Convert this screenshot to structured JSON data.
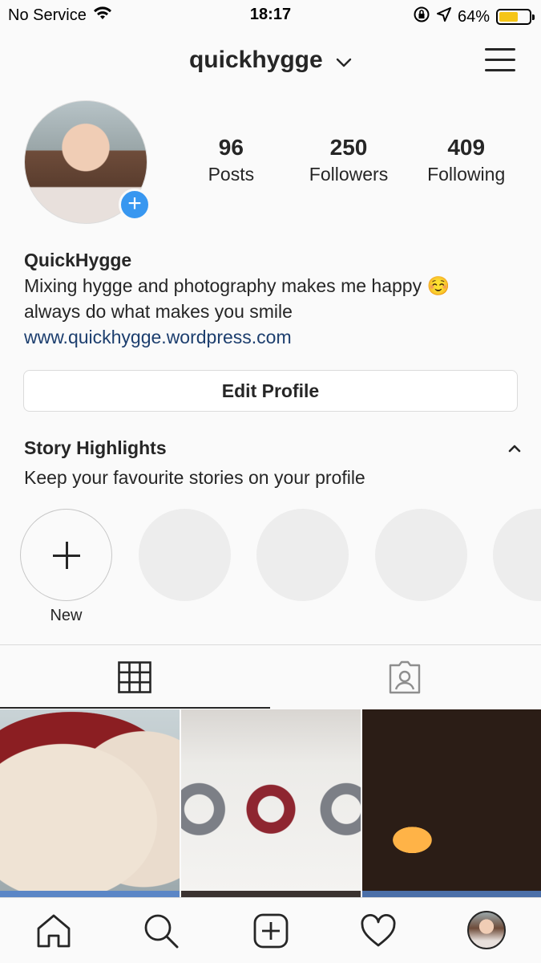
{
  "status_bar": {
    "carrier": "No Service",
    "time": "18:17",
    "battery_percent": "64%",
    "battery_level": 0.64
  },
  "header": {
    "username": "quickhygge"
  },
  "profile": {
    "stats": [
      {
        "value": "96",
        "label": "Posts"
      },
      {
        "value": "250",
        "label": "Followers"
      },
      {
        "value": "409",
        "label": "Following"
      }
    ],
    "name": "QuickHygge",
    "bio_line1": "Mixing hygge and photography makes me happy ☺️",
    "bio_line2": "always do what makes you smile",
    "website": "www.quickhygge.wordpress.com",
    "edit_button": "Edit Profile"
  },
  "highlights": {
    "title": "Story Highlights",
    "subtitle": "Keep your favourite stories on your profile",
    "new_label": "New"
  },
  "icons": {
    "status": [
      "wifi-icon",
      "orientation-lock-icon",
      "location-arrow-icon",
      "battery-icon"
    ],
    "header": [
      "chevron-down-icon",
      "menu-icon"
    ],
    "tabs": [
      "grid-icon",
      "tagged-icon"
    ],
    "bottom_nav": [
      "home-icon",
      "search-icon",
      "new-post-icon",
      "heart-icon",
      "profile-avatar"
    ]
  },
  "colors": {
    "accent": "#3897f0",
    "link": "#1c3e6e",
    "battery": "#f5c518"
  }
}
